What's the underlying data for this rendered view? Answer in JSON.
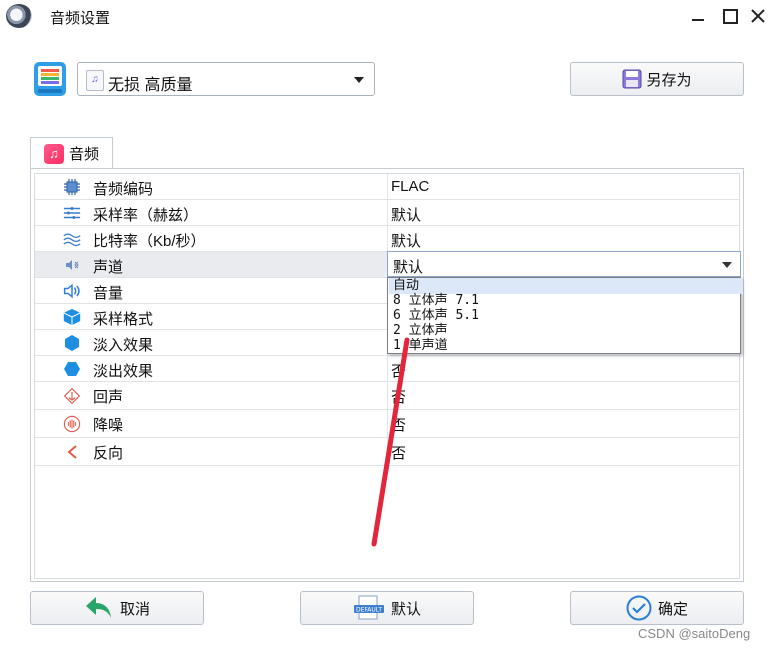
{
  "window": {
    "title": "音频设置"
  },
  "preset": {
    "selected": "无损 高质量",
    "file_icon_label": "♫"
  },
  "toolbar": {
    "save_as_label": "另存为"
  },
  "tabs": [
    {
      "label": "音频",
      "active": true
    }
  ],
  "settings": [
    {
      "name": "音频编码",
      "value": "FLAC",
      "icon": "chip-icon"
    },
    {
      "name": "采样率（赫兹）",
      "value": "默认",
      "icon": "sample-rate-icon"
    },
    {
      "name": "比特率（Kb/秒）",
      "value": "默认",
      "icon": "wave-icon"
    },
    {
      "name": "声道",
      "value": "默认",
      "icon": "channel-icon",
      "selected": true
    },
    {
      "name": "音量",
      "value": "",
      "icon": "speaker-icon"
    },
    {
      "name": "采样格式",
      "value": "",
      "icon": "cube-icon"
    },
    {
      "name": "淡入效果",
      "value": "",
      "icon": "fade-in-icon"
    },
    {
      "name": "淡出效果",
      "value": "否",
      "icon": "fade-out-icon"
    },
    {
      "name": "回声",
      "value": "否",
      "icon": "echo-icon"
    },
    {
      "name": "降噪",
      "value": "否",
      "icon": "noise-reduction-icon"
    },
    {
      "name": "反向",
      "value": "否",
      "icon": "reverse-icon"
    }
  ],
  "channel_dropdown": {
    "current": "默认",
    "options": [
      "自动",
      "8 立体声 7.1",
      "6 立体声 5.1",
      "2 立体声",
      "1 单声道"
    ],
    "highlighted": "自动"
  },
  "buttons": {
    "cancel": "取消",
    "default": "默认",
    "default_icon_text": "DEFAULT",
    "ok": "确定"
  },
  "watermark": "CSDN @saitoDeng",
  "colors": {
    "accent_pink": "#ff2d63",
    "annotation_red": "#e3263b",
    "ok_blue": "#2a7fd8",
    "cancel_green": "#2aa56a"
  }
}
